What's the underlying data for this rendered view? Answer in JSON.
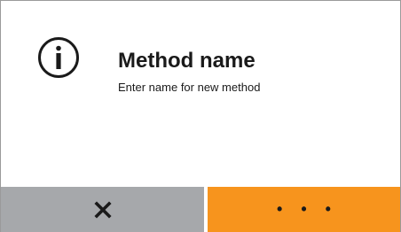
{
  "dialog": {
    "icon": "info-circle-icon",
    "title": "Method name",
    "subtitle": "Enter name for new method"
  },
  "buttons": {
    "cancel_icon": "close-x-icon",
    "more_label": "• • •"
  },
  "colors": {
    "cancel_bg": "#a6a8ab",
    "more_bg": "#f7941d",
    "text": "#1a1a1a",
    "border": "#9a9a9a"
  }
}
